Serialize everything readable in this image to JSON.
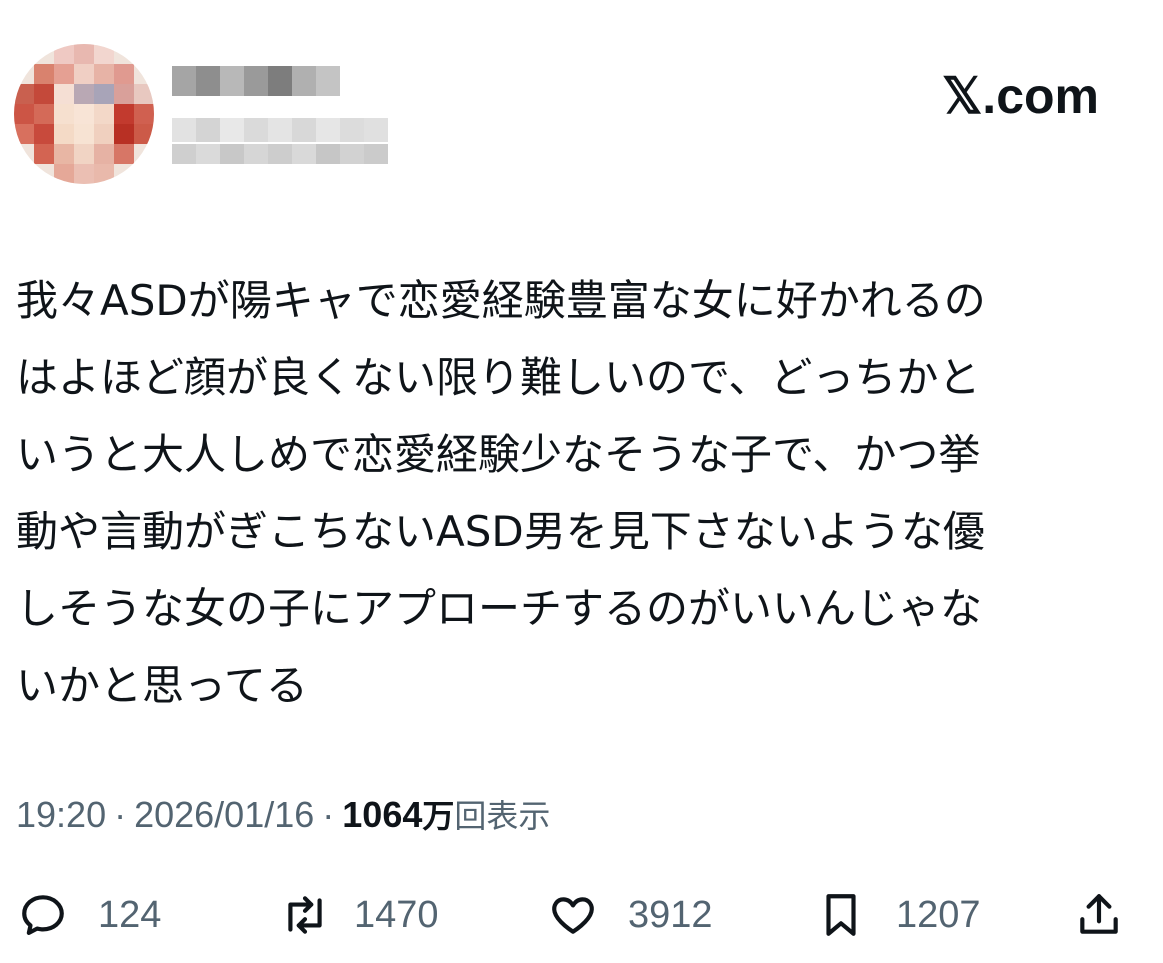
{
  "header": {
    "avatar_icon": "user-avatar-pixelated",
    "display_name": "",
    "handle": "",
    "brand": "𝕏.com"
  },
  "tweet": {
    "lines": [
      "我々ASDが陽キャで恋愛経験豊富な女に好かれるの",
      "はよほど顔が良くない限り難しいので、どっちかと",
      "いうと大人しめで恋愛経験少なそうな子で、かつ挙",
      "動や言動がぎこちないASD男を見下さないような優",
      "しそうな女の子にアプローチするのがいいんじゃな",
      "いかと思ってる"
    ]
  },
  "meta": {
    "time": "19:20",
    "separator": "·",
    "date": "2026/01/16",
    "views_count": "1064",
    "views_unit": "万",
    "views_label": "回表示"
  },
  "actions": {
    "reply": {
      "icon": "reply-icon",
      "count": "124"
    },
    "repost": {
      "icon": "repost-icon",
      "count": "1470"
    },
    "like": {
      "icon": "heart-icon",
      "count": "3912"
    },
    "bookmark": {
      "icon": "bookmark-icon",
      "count": "1207"
    },
    "share": {
      "icon": "share-icon"
    }
  },
  "colors": {
    "text": "#0f1419",
    "secondary": "#536471",
    "background": "#ffffff"
  }
}
